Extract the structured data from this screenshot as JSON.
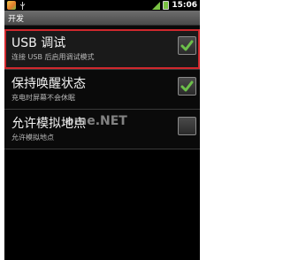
{
  "status_bar": {
    "time": "15:06"
  },
  "title_bar": {
    "title": "开发"
  },
  "settings": [
    {
      "title": "USB 调试",
      "subtitle": "连接 USB 后启用调试模式",
      "checked": true
    },
    {
      "title": "保持唤醒状态",
      "subtitle": "充电时屏幕不会休眠",
      "checked": true
    },
    {
      "title": "允许模拟地点",
      "subtitle": "允许模拟地点",
      "checked": false
    }
  ],
  "watermark": "ome.NET",
  "colors": {
    "highlight_border": "#d0282d",
    "check_green": "#6cc04a"
  }
}
